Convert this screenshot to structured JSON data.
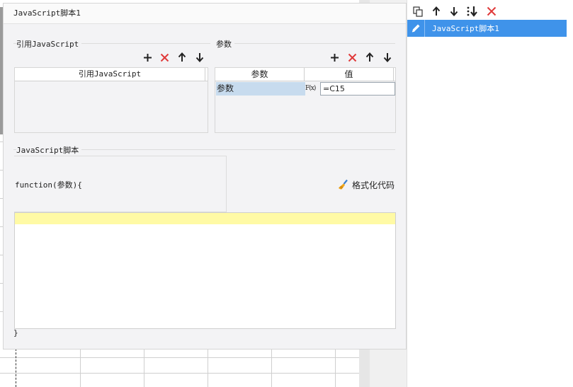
{
  "dialog": {
    "title": "JavaScript脚本1"
  },
  "references": {
    "group_label": "引用JavaScript",
    "column_header": "引用JavaScript",
    "toolbar": [
      "add-icon",
      "delete-icon",
      "move-up-icon",
      "move-down-icon"
    ]
  },
  "params": {
    "group_label": "参数",
    "columns": [
      "参数",
      "值"
    ],
    "rows": [
      {
        "name": "参数",
        "formula_icon": "F(x)",
        "value": "=C15"
      }
    ],
    "toolbar": [
      "add-icon",
      "delete-icon",
      "move-up-icon",
      "move-down-icon"
    ]
  },
  "script": {
    "group_label": "JavaScript脚本",
    "function_open": "function(参数){",
    "function_close": "}",
    "format_label": "格式化代码",
    "code": ""
  },
  "side_panel": {
    "toolbar": [
      "copy-icon",
      "move-up-icon",
      "move-down-icon",
      "move-to-bottom-icon",
      "delete-icon"
    ],
    "items": [
      {
        "label": "JavaScript脚本1",
        "selected": true
      }
    ]
  },
  "colors": {
    "accent": "#3f93ea",
    "delete": "#e03a3a",
    "highlight_line": "#fffaa5",
    "selected_cell": "#c7dbee"
  }
}
